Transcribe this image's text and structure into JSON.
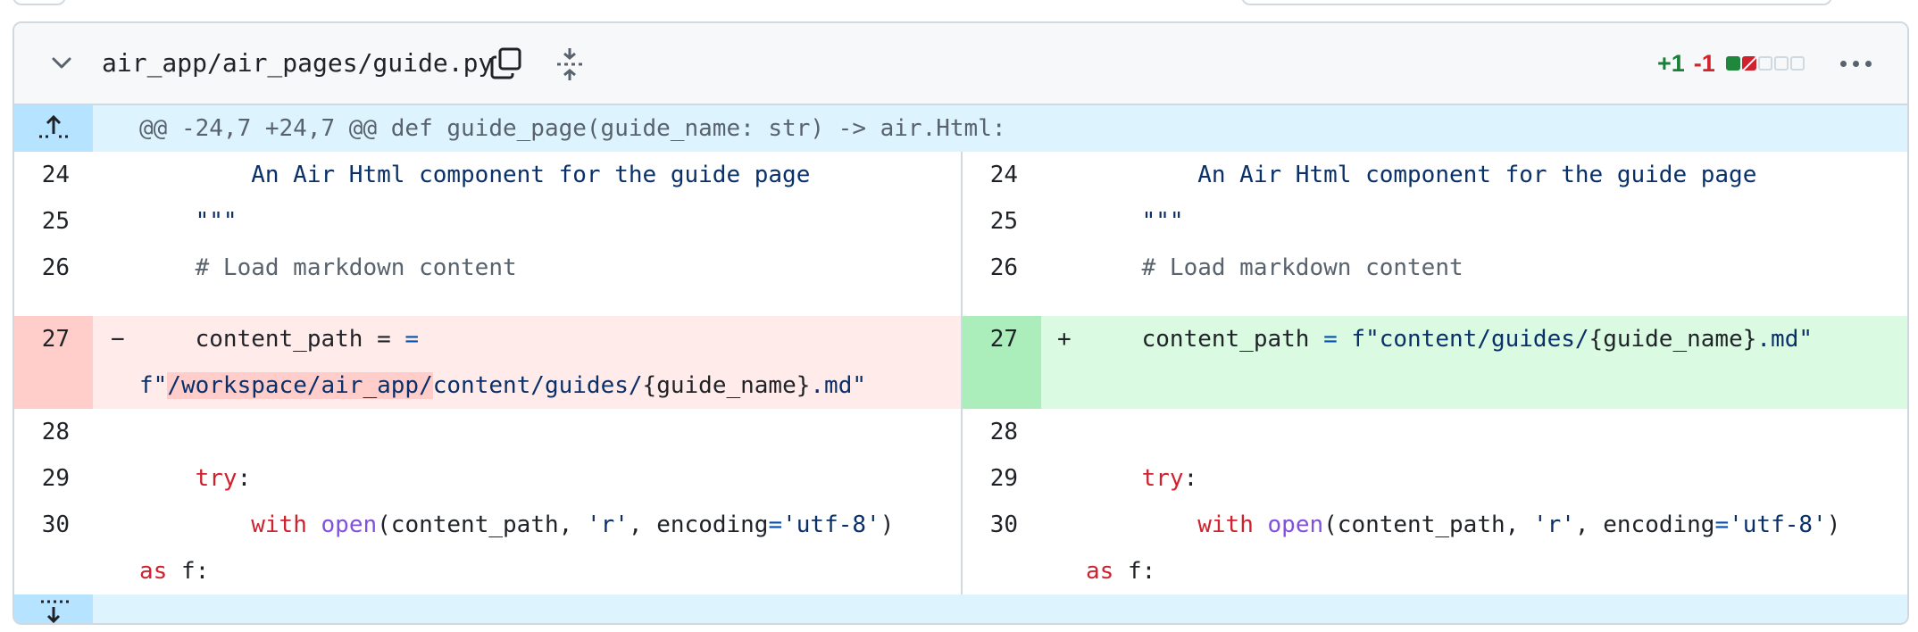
{
  "file": {
    "path": "air_app/air_pages/guide.py",
    "additions": "+1",
    "deletions": "-1",
    "icons": [
      "chevron-down-icon",
      "copy-icon",
      "expand-icon",
      "kebab-icon"
    ]
  },
  "hunk": {
    "header": "@@ -24,7 +24,7 @@ def guide_page(guide_name: str) -> air.Html:"
  },
  "lines": {
    "l24": "24",
    "l25": "25",
    "l26": "26",
    "l27": "27",
    "l28": "28",
    "l29": "29",
    "l30": "30",
    "r24": "24",
    "r25": "25",
    "r26": "26",
    "r27": "27",
    "r28": "28",
    "r29": "29",
    "r30": "30"
  },
  "code": {
    "docline": "        An Air Html component for the guide page",
    "quotes": "    \"\"\"",
    "comment": "    # Load markdown content",
    "del_marker": "−",
    "add_marker": "+",
    "del_var": "    content_path =",
    "del_cont_prefix": "f\"",
    "del_cont_hl": "/workspace/air_app/",
    "del_cont_rest": "content/guides/",
    "brace_open": "{",
    "guide_name": "guide_name",
    "brace_close": "}",
    "md": ".md\"",
    "add_var": "    content_path ",
    "eq": "=",
    "add_str1": " f\"content/guides/",
    "try_kw": "try",
    "colon": ":",
    "with_kw": "with",
    "open_fn": "open",
    "open_args1": "(content_path, ",
    "r_str": "'r'",
    "comma_enc": ", encoding",
    "utf8": "'utf-8'",
    "paren_close": ")",
    "as_kw": "as",
    "f_var": " f:"
  },
  "colors": {
    "added": "#1a7f37",
    "deleted": "#d1242f",
    "hunk_bg": "#ddf4ff",
    "del_bg": "#ffebe9",
    "add_bg": "#dafbe1"
  }
}
